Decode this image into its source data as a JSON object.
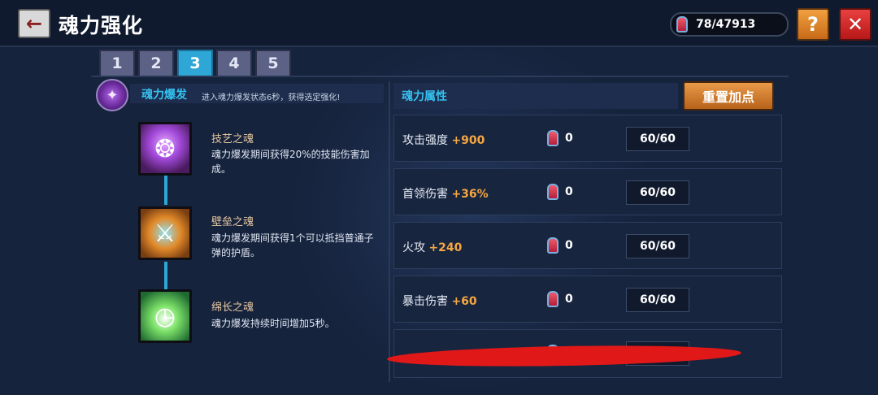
{
  "header": {
    "title": "魂力强化",
    "currency_value": "78/47913",
    "help_label": "?",
    "close_label": "✕",
    "back_label": "←"
  },
  "tabs": [
    {
      "label": "1",
      "active": false
    },
    {
      "label": "2",
      "active": false
    },
    {
      "label": "3",
      "active": true
    },
    {
      "label": "4",
      "active": false
    },
    {
      "label": "5",
      "active": false
    }
  ],
  "burst": {
    "title": "魂力爆发",
    "description": "进入魂力爆发状态6秒，获得选定强化!",
    "icon": "soul-crystal-icon"
  },
  "skills": [
    {
      "name": "技艺之魂",
      "description": "魂力爆发期间获得20%的技能伤害加成。",
      "icon": "purple-flame-book-icon"
    },
    {
      "name": "壁垒之魂",
      "description": "魂力爆发期间获得1个可以抵挡普通子弹的护盾。",
      "icon": "shield-axe-icon"
    },
    {
      "name": "绵长之魂",
      "description": "魂力爆发持续时间增加5秒。",
      "icon": "stopwatch-icon"
    }
  ],
  "attributes": {
    "title": "魂力属性",
    "reset_label": "重置加点",
    "rows": [
      {
        "label": "攻击强度",
        "bonus": "+900",
        "count": "0",
        "capacity": "60/60"
      },
      {
        "label": "首领伤害",
        "bonus": "+36%",
        "count": "0",
        "capacity": "60/60"
      },
      {
        "label": "火攻",
        "bonus": "+240",
        "count": "0",
        "capacity": "60/60"
      },
      {
        "label": "暴击伤害",
        "bonus": "+60",
        "count": "0",
        "capacity": "60/60"
      }
    ]
  },
  "colors": {
    "accent": "#2fa7d6",
    "bonus": "#f5a742",
    "close": "#d82a2a",
    "help": "#e08a30",
    "scribble": "#e01818"
  }
}
